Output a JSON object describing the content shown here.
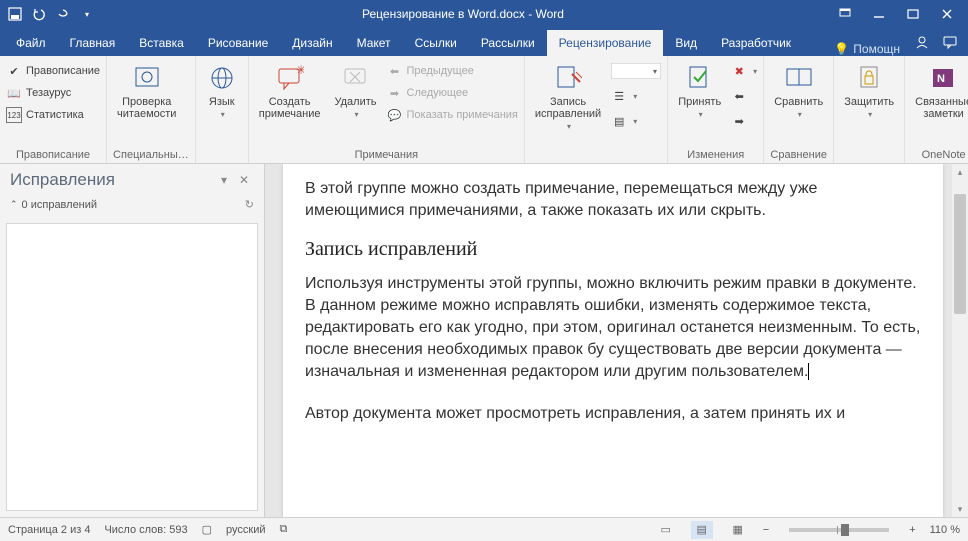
{
  "title": "Рецензирование в Word.docx  -  Word",
  "tabs": [
    "Файл",
    "Главная",
    "Вставка",
    "Рисование",
    "Дизайн",
    "Макет",
    "Ссылки",
    "Рассылки",
    "Рецензирование",
    "Вид",
    "Разработчик"
  ],
  "active_tab": 8,
  "help": "Помощн",
  "ribbon": {
    "proof": {
      "check_spelling": "Правописание",
      "thesaurus": "Тезаурус",
      "statistics": "Статистика",
      "group_label": "Правописание"
    },
    "readability": {
      "label1": "Проверка",
      "label2": "читаемости",
      "group_label": "Специальны…"
    },
    "language": {
      "label": "Язык",
      "group_label": ""
    },
    "comments": {
      "new": "Создать\nпримечание",
      "delete": "Удалить",
      "previous": "Предыдущее",
      "next": "Следующее",
      "show": "Показать примечания",
      "group_label": "Примечания"
    },
    "tracking": {
      "track": "Запись\nисправлений",
      "group_label": ""
    },
    "changes": {
      "accept": "Принять",
      "group_label": "Изменения"
    },
    "compare": {
      "label": "Сравнить",
      "group_label": "Сравнение"
    },
    "protect": {
      "label": "Защитить",
      "group_label": ""
    },
    "onenote": {
      "label": "Связанные\nзаметки",
      "group_label": "OneNote"
    }
  },
  "revisions_pane": {
    "title": "Исправления",
    "sub_label": "0 исправлений"
  },
  "document": {
    "p1": "В этой группе можно создать примечание, перемещаться между уже имеющимися примечаниями, а также показать их или скрыть.",
    "h1": "Запись исправлений",
    "p2": "Используя инструменты этой группы, можно включить режим правки в документе. В данном режиме можно исправлять ошибки, изменять содержимое текста, редактировать его как угодно, при этом, оригинал останется неизменным. То есть, после внесения необходимых правок бу существовать две версии документа — изначальная и измененная редактором или другим пользователем.",
    "p3": "Автор документа может просмотреть исправления, а затем принять их и"
  },
  "statusbar": {
    "page": "Страница 2 из 4",
    "words": "Число слов: 593",
    "lang": "русский",
    "zoom": "110 %"
  }
}
